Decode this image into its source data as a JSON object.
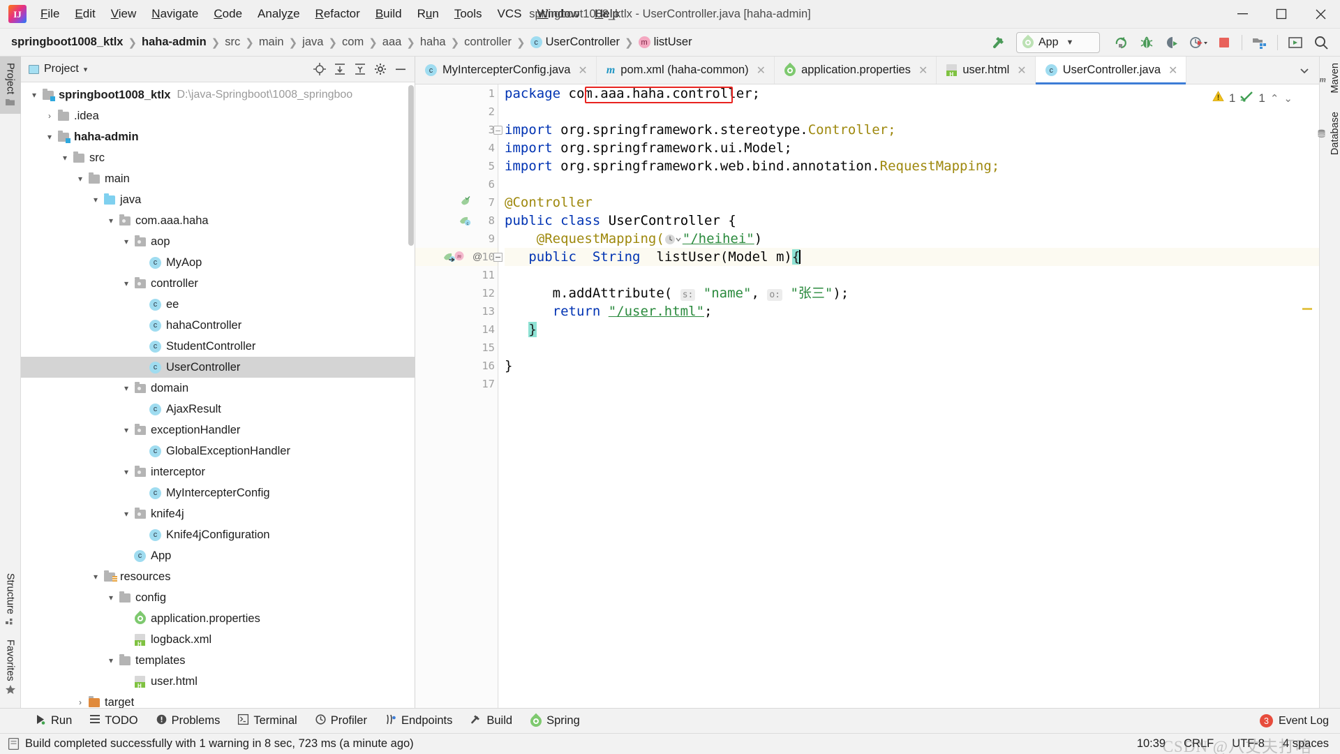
{
  "window": {
    "title": "springboot1008_ktlx - UserController.java [haha-admin]",
    "logo_text": "IJ",
    "minimize": "–",
    "maximize": "▢",
    "close": "✕"
  },
  "menubar": [
    {
      "label": "File",
      "accel": "F"
    },
    {
      "label": "Edit",
      "accel": "E"
    },
    {
      "label": "View",
      "accel": "V"
    },
    {
      "label": "Navigate",
      "accel": "N"
    },
    {
      "label": "Code",
      "accel": "C"
    },
    {
      "label": "Analyze",
      "accel": "z"
    },
    {
      "label": "Refactor",
      "accel": "R"
    },
    {
      "label": "Build",
      "accel": "B"
    },
    {
      "label": "Run",
      "accel": "u"
    },
    {
      "label": "Tools",
      "accel": "T"
    },
    {
      "label": "VCS",
      "accel": ""
    },
    {
      "label": "Window",
      "accel": "W"
    },
    {
      "label": "Help",
      "accel": "H"
    }
  ],
  "breadcrumb": [
    {
      "label": "springboot1008_ktlx",
      "bold": true,
      "icon": ""
    },
    {
      "label": "haha-admin",
      "bold": true,
      "icon": ""
    },
    {
      "label": "src",
      "bold": false,
      "icon": ""
    },
    {
      "label": "main",
      "bold": false,
      "icon": ""
    },
    {
      "label": "java",
      "bold": false,
      "icon": ""
    },
    {
      "label": "com",
      "bold": false,
      "icon": ""
    },
    {
      "label": "aaa",
      "bold": false,
      "icon": ""
    },
    {
      "label": "haha",
      "bold": false,
      "icon": ""
    },
    {
      "label": "controller",
      "bold": false,
      "icon": ""
    },
    {
      "label": "UserController",
      "bold": false,
      "icon": "class-badge"
    },
    {
      "label": "listUser",
      "bold": false,
      "icon": "method-badge"
    }
  ],
  "toolbar": {
    "build_hammer_icon": "hammer-icon",
    "run_config_label": "App",
    "run_config_dropdown": "▼",
    "buttons": [
      {
        "name": "rerun-icon",
        "title": "Rerun"
      },
      {
        "name": "debug-icon",
        "title": "Debug"
      },
      {
        "name": "run-with-coverage-icon",
        "title": "Run with Coverage"
      },
      {
        "name": "profiler-icon",
        "title": "Profiler"
      },
      {
        "name": "stop-icon",
        "title": "Stop"
      },
      {
        "name": "project-structure-icon",
        "title": "Project Structure"
      },
      {
        "name": "select-in-icon",
        "title": "Select In"
      },
      {
        "name": "search-everywhere-icon",
        "title": "Search Everywhere"
      }
    ]
  },
  "left_stripe": {
    "top": [
      {
        "label": "Project",
        "selected": true,
        "icon": "folder-icon"
      }
    ],
    "bottom": [
      {
        "label": "Structure",
        "selected": false,
        "icon": "structure-icon"
      },
      {
        "label": "Favorites",
        "selected": false,
        "icon": "star-icon"
      }
    ]
  },
  "right_stripe": [
    {
      "label": "Maven",
      "icon": "maven-icon"
    },
    {
      "label": "Database",
      "icon": "database-icon"
    }
  ],
  "project_panel": {
    "title": "Project",
    "dropdown": "▾",
    "tools": [
      {
        "name": "locate-file-icon",
        "title": "Select Opened File"
      },
      {
        "name": "expand-all-icon",
        "title": "Expand All"
      },
      {
        "name": "collapse-all-icon",
        "title": "Collapse All"
      },
      {
        "name": "settings-gear-icon",
        "title": "Settings"
      },
      {
        "name": "hide-panel-icon",
        "title": "Hide"
      }
    ],
    "tree": [
      {
        "label": "springboot1008_ktlx",
        "path": "D:\\java-Springboot\\1008_springboo",
        "indent": 0,
        "arrow": "▾",
        "icon": "module-folder",
        "bold": true,
        "selected": false
      },
      {
        "label": ".idea",
        "path": "",
        "indent": 1,
        "arrow": "›",
        "icon": "folder",
        "bold": false,
        "selected": false
      },
      {
        "label": "haha-admin",
        "path": "",
        "indent": 1,
        "arrow": "▾",
        "icon": "module-folder",
        "bold": true,
        "selected": false
      },
      {
        "label": "src",
        "path": "",
        "indent": 2,
        "arrow": "▾",
        "icon": "folder",
        "bold": false,
        "selected": false
      },
      {
        "label": "main",
        "path": "",
        "indent": 3,
        "arrow": "▾",
        "icon": "folder",
        "bold": false,
        "selected": false
      },
      {
        "label": "java",
        "path": "",
        "indent": 4,
        "arrow": "▾",
        "icon": "source-folder",
        "bold": false,
        "selected": false
      },
      {
        "label": "com.aaa.haha",
        "path": "",
        "indent": 5,
        "arrow": "▾",
        "icon": "package",
        "bold": false,
        "selected": false
      },
      {
        "label": "aop",
        "path": "",
        "indent": 6,
        "arrow": "▾",
        "icon": "package",
        "bold": false,
        "selected": false
      },
      {
        "label": "MyAop",
        "path": "",
        "indent": 7,
        "arrow": "",
        "icon": "class",
        "bold": false,
        "selected": false
      },
      {
        "label": "controller",
        "path": "",
        "indent": 6,
        "arrow": "▾",
        "icon": "package",
        "bold": false,
        "selected": false
      },
      {
        "label": "ee",
        "path": "",
        "indent": 7,
        "arrow": "",
        "icon": "class",
        "bold": false,
        "selected": false
      },
      {
        "label": "hahaController",
        "path": "",
        "indent": 7,
        "arrow": "",
        "icon": "class",
        "bold": false,
        "selected": false
      },
      {
        "label": "StudentController",
        "path": "",
        "indent": 7,
        "arrow": "",
        "icon": "class",
        "bold": false,
        "selected": false
      },
      {
        "label": "UserController",
        "path": "",
        "indent": 7,
        "arrow": "",
        "icon": "class",
        "bold": false,
        "selected": true
      },
      {
        "label": "domain",
        "path": "",
        "indent": 6,
        "arrow": "▾",
        "icon": "package",
        "bold": false,
        "selected": false
      },
      {
        "label": "AjaxResult",
        "path": "",
        "indent": 7,
        "arrow": "",
        "icon": "class",
        "bold": false,
        "selected": false
      },
      {
        "label": "exceptionHandler",
        "path": "",
        "indent": 6,
        "arrow": "▾",
        "icon": "package",
        "bold": false,
        "selected": false
      },
      {
        "label": "GlobalExceptionHandler",
        "path": "",
        "indent": 7,
        "arrow": "",
        "icon": "class",
        "bold": false,
        "selected": false
      },
      {
        "label": "interceptor",
        "path": "",
        "indent": 6,
        "arrow": "▾",
        "icon": "package",
        "bold": false,
        "selected": false
      },
      {
        "label": "MyIntercepterConfig",
        "path": "",
        "indent": 7,
        "arrow": "",
        "icon": "class",
        "bold": false,
        "selected": false
      },
      {
        "label": "knife4j",
        "path": "",
        "indent": 6,
        "arrow": "▾",
        "icon": "package",
        "bold": false,
        "selected": false
      },
      {
        "label": "Knife4jConfiguration",
        "path": "",
        "indent": 7,
        "arrow": "",
        "icon": "class",
        "bold": false,
        "selected": false
      },
      {
        "label": "App",
        "path": "",
        "indent": 6,
        "arrow": "",
        "icon": "spring-class",
        "bold": false,
        "selected": false
      },
      {
        "label": "resources",
        "path": "",
        "indent": 4,
        "arrow": "▾",
        "icon": "resource-folder",
        "bold": false,
        "selected": false
      },
      {
        "label": "config",
        "path": "",
        "indent": 5,
        "arrow": "▾",
        "icon": "folder",
        "bold": false,
        "selected": false
      },
      {
        "label": "application.properties",
        "path": "",
        "indent": 6,
        "arrow": "",
        "icon": "spring-file",
        "bold": false,
        "selected": false
      },
      {
        "label": "logback.xml",
        "path": "",
        "indent": 6,
        "arrow": "",
        "icon": "xml-file",
        "bold": false,
        "selected": false
      },
      {
        "label": "templates",
        "path": "",
        "indent": 5,
        "arrow": "▾",
        "icon": "folder",
        "bold": false,
        "selected": false
      },
      {
        "label": "user.html",
        "path": "",
        "indent": 6,
        "arrow": "",
        "icon": "html-file",
        "bold": false,
        "selected": false
      },
      {
        "label": "target",
        "path": "",
        "indent": 3,
        "arrow": "›",
        "icon": "target-folder",
        "bold": false,
        "selected": false
      }
    ]
  },
  "editor_tabs": [
    {
      "label": "MyIntercepterConfig.java",
      "icon": "class",
      "active": false,
      "close": "✕"
    },
    {
      "label": "pom.xml (haha-common)",
      "icon": "maven",
      "active": false,
      "close": "✕"
    },
    {
      "label": "application.properties",
      "icon": "spring",
      "active": false,
      "close": "✕"
    },
    {
      "label": "user.html",
      "icon": "html",
      "active": false,
      "close": "✕"
    },
    {
      "label": "UserController.java",
      "icon": "class",
      "active": true,
      "close": "✕"
    }
  ],
  "editor": {
    "inspections": {
      "warning_count": "1",
      "check_count": "1",
      "prev": "⌃",
      "next": "⌄"
    },
    "highlighted_text": "springframework.ui",
    "lines": [
      {
        "n": "1",
        "current": false,
        "gutter": ""
      },
      {
        "n": "2",
        "current": false,
        "gutter": ""
      },
      {
        "n": "3",
        "current": false,
        "gutter": "fold-open"
      },
      {
        "n": "4",
        "current": false,
        "gutter": ""
      },
      {
        "n": "5",
        "current": false,
        "gutter": "fold-close"
      },
      {
        "n": "6",
        "current": false,
        "gutter": ""
      },
      {
        "n": "7",
        "current": false,
        "gutter": "spring-bean"
      },
      {
        "n": "8",
        "current": false,
        "gutter": "spring-bean-class"
      },
      {
        "n": "9",
        "current": false,
        "gutter": ""
      },
      {
        "n": "10",
        "current": true,
        "gutter": "mapping-method"
      },
      {
        "n": "11",
        "current": false,
        "gutter": ""
      },
      {
        "n": "12",
        "current": false,
        "gutter": ""
      },
      {
        "n": "13",
        "current": false,
        "gutter": ""
      },
      {
        "n": "14",
        "current": false,
        "gutter": "fold-close2"
      },
      {
        "n": "15",
        "current": false,
        "gutter": ""
      },
      {
        "n": "16",
        "current": false,
        "gutter": ""
      },
      {
        "n": "17",
        "current": false,
        "gutter": ""
      }
    ],
    "code_text": {
      "l1": "package com.aaa.haha.controller;",
      "l3": "import org.springframework.stereotype.Controller;",
      "l4": "import org.springframework.ui.Model;",
      "l5": "import org.springframework.web.bind.annotation.RequestMapping;",
      "l7": "@Controller",
      "l8": "public class UserController {",
      "l9": "@RequestMapping(\"/heihei\")",
      "l10": "public  String  listUser(Model m){",
      "l12": "m.addAttribute( s: \"name\", o: \"张三\");",
      "l13": "return \"/user.html\";",
      "l14": "}",
      "l16": "}"
    },
    "tokens": {
      "kw_package": "package",
      "pkg_name": "com.aaa.haha.controller;",
      "kw_import": "import",
      "imp3_a": "org.springframework.stereotype.",
      "imp3_b": "Controller;",
      "imp4_a": "org.",
      "imp4_hl": "springframework.ui",
      "imp4_b": ".Model;",
      "imp5_a": "org.springframework.web.bind.annotation.",
      "imp5_b": "RequestMapping;",
      "ann_controller": "@Controller",
      "kw_public": "public",
      "kw_class": "class",
      "cls_name": "UserController {",
      "ann_requestmapping": "@RequestMapping(",
      "rm_value": "\"/heihei\"",
      "rm_close": ")",
      "m_public": "public",
      "m_string": "String",
      "m_name": "listUser(Model m)",
      "m_brace": "{",
      "call_obj": "m.addAttribute(",
      "hint_s": "s:",
      "arg_name": "\"name\"",
      "comma": ",",
      "hint_o": "o:",
      "arg_val": "\"张三\"",
      "call_close": ");",
      "kw_return": "return",
      "ret_val": "\"/user.html\"",
      "semi": ";",
      "close_brace_inner": "}",
      "close_brace_outer": "}"
    }
  },
  "bottom_bar": {
    "items": [
      {
        "label": "Run",
        "icon": "run-icon"
      },
      {
        "label": "TODO",
        "icon": "todo-icon"
      },
      {
        "label": "Problems",
        "icon": "problems-icon"
      },
      {
        "label": "Terminal",
        "icon": "terminal-icon"
      },
      {
        "label": "Profiler",
        "icon": "profiler-icon"
      },
      {
        "label": "Endpoints",
        "icon": "endpoints-icon"
      },
      {
        "label": "Build",
        "icon": "build-hammer-icon"
      },
      {
        "label": "Spring",
        "icon": "spring-leaf-icon"
      }
    ],
    "event_log": {
      "label": "Event Log",
      "count": "3"
    }
  },
  "statusbar": {
    "message": "Build completed successfully with 1 warning in 8 sec, 723 ms (a minute ago)",
    "time": "10:39",
    "line_separator": "CRLF",
    "encoding": "UTF-8",
    "indent": "4 spaces",
    "watermark": "CSDN @八丈夫打咯"
  },
  "colors": {
    "accent_blue": "#3d7dd6",
    "keyword": "#0033b3",
    "string": "#2a8a3d",
    "annotation": "#9e880d",
    "highlight_red": "#e8231f",
    "selection_gray": "#d4d4d4",
    "current_line": "#fcfaf1"
  }
}
